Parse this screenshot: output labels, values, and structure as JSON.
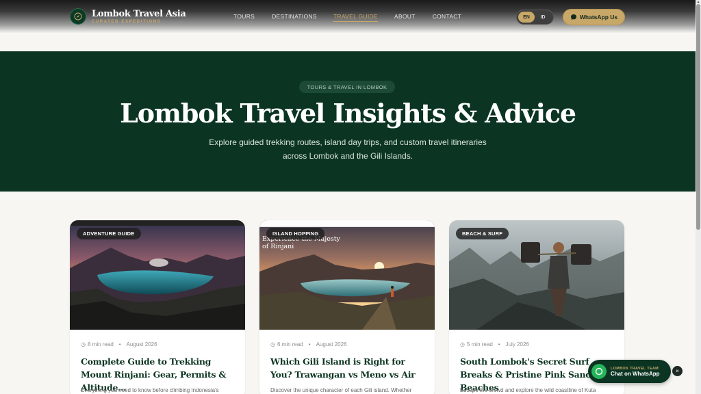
{
  "header": {
    "brand_name": "Lombok Travel Asia",
    "brand_tagline": "CURATED EXPEDITIONS",
    "logo_icon": "compass-icon",
    "nav": [
      "TOURS",
      "DESTINATIONS",
      "TRAVEL GUIDE",
      "ABOUT",
      "CONTACT"
    ],
    "active_nav": "TRAVEL GUIDE",
    "languages": [
      "EN",
      "ID"
    ],
    "active_language": "EN",
    "whatsapp_label": "WhatsApp Us"
  },
  "hero": {
    "badge": "TOURS & TRAVEL IN LOMBOK",
    "title": "Lombok Travel Insights & Advice",
    "subtitle_line1": "Explore guided trekking routes, island day trips, and custom travel itineraries",
    "subtitle_line2": "across Lombok and the Gili Islands."
  },
  "cards": [
    {
      "category": "ADVENTURE GUIDE",
      "read_time": "8 min read",
      "date": "August 2026",
      "title": "Complete Guide to Trekking Mount Rinjani: Gear, Permits & Altitude...",
      "excerpt": "Everything you need to know before climbing Indonesia's"
    },
    {
      "category": "ISLAND HOPPING",
      "read_time": "6 min read",
      "date": "August 2026",
      "title": "Which Gili Island is Right for You? Trawangan vs Meno vs Air",
      "excerpt": "Discover the unique character of each Gili island. Whether",
      "image_overlay": "Experience the Majesty of Rinjani"
    },
    {
      "category": "BEACH & SURF",
      "read_time": "5 min read",
      "date": "July 2026",
      "title": "South Lombok's Secret Surf Breaks & Pristine Pink Sand Beaches",
      "excerpt": "Escape the crowd and explore the wild coastline of Kuta"
    }
  ],
  "chat_widget": {
    "team": "LOMBOK TRAVEL TEAM",
    "cta": "Chat on WhatsApp",
    "close": "×"
  }
}
